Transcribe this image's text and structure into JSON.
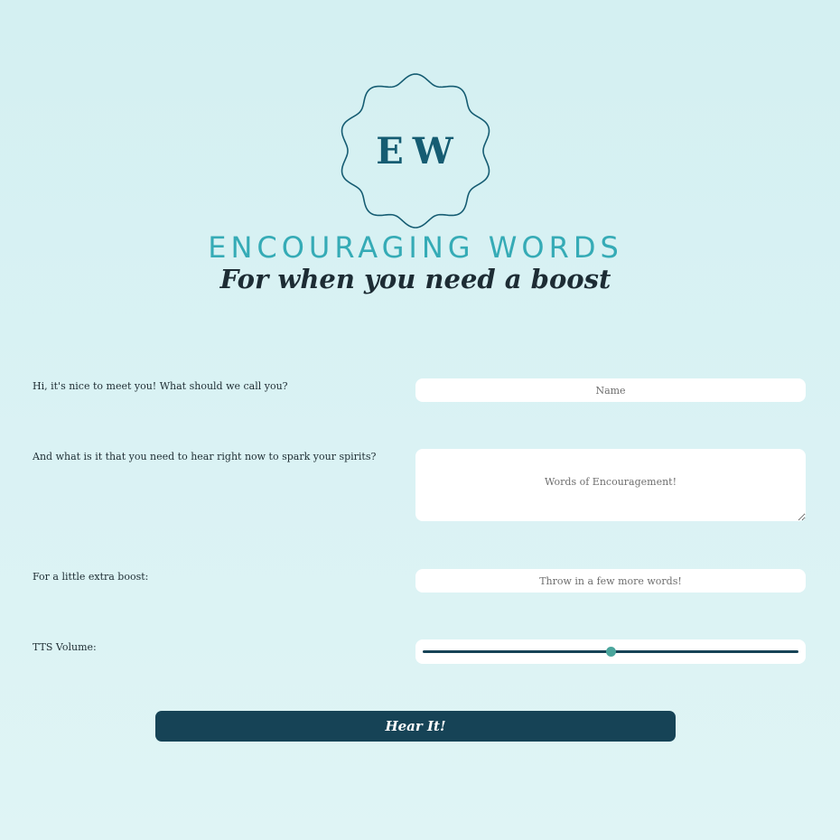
{
  "colors": {
    "background": "#d6f1f3",
    "brand_dark": "#164356",
    "brand_teal": "#35abb6",
    "slider_thumb": "#4aa59c"
  },
  "logo": {
    "initials": "EW",
    "icon": "scalloped-badge-icon"
  },
  "header": {
    "title": "ENCOURAGING WORDS",
    "subtitle": "For when you need a boost"
  },
  "form": {
    "name": {
      "label": "Hi, it's nice to meet you! What should we call you?",
      "placeholder": "Name",
      "value": ""
    },
    "words": {
      "label": "And what is it that you need to hear right now to spark your spirits?",
      "placeholder": "Words of Encouragement!",
      "value": ""
    },
    "extra": {
      "label": "For a little extra boost:",
      "placeholder": "Throw in a few more words!",
      "value": ""
    },
    "volume": {
      "label": "TTS Volume:",
      "value": 0.5
    },
    "submit_label": "Hear It!"
  }
}
